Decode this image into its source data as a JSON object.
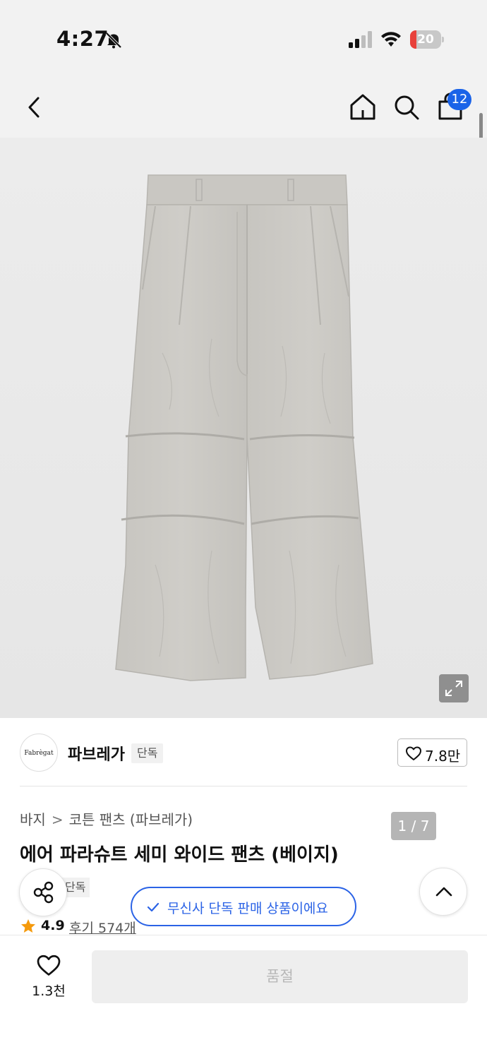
{
  "status_bar": {
    "time": "4:27",
    "battery_level": "20",
    "battery_fraction": 0.2
  },
  "nav": {
    "back_icon": "chevron-left-icon",
    "home_icon": "home-icon",
    "search_icon": "search-icon",
    "cart_icon": "shopping-bag-icon",
    "cart_badge": "12"
  },
  "gallery": {
    "counter": "1 / 7",
    "expand_icon": "expand-icon"
  },
  "brand": {
    "logo_text": "Fabrègat",
    "name": "파브레가",
    "exclusive_label": "단독",
    "like_count": "7.8만"
  },
  "breadcrumb": {
    "items": [
      "바지",
      "코튼 팬츠 (파브레가)"
    ]
  },
  "product": {
    "title": "에어 파라슈트 세미 와이드 팬츠 (베이지)",
    "exclusive_label": "단독",
    "rating": "4.9",
    "reviews": "후기 574개"
  },
  "toast": {
    "text": "무신사 단독 판매 상품이에요"
  },
  "bottom_bar": {
    "wish_count": "1.3천",
    "soldout_label": "품절"
  },
  "colors": {
    "accent_blue": "#2b63e6",
    "badge_blue": "#1a63e8",
    "star_orange": "#f59a0c",
    "battery_red": "#e8413b"
  }
}
